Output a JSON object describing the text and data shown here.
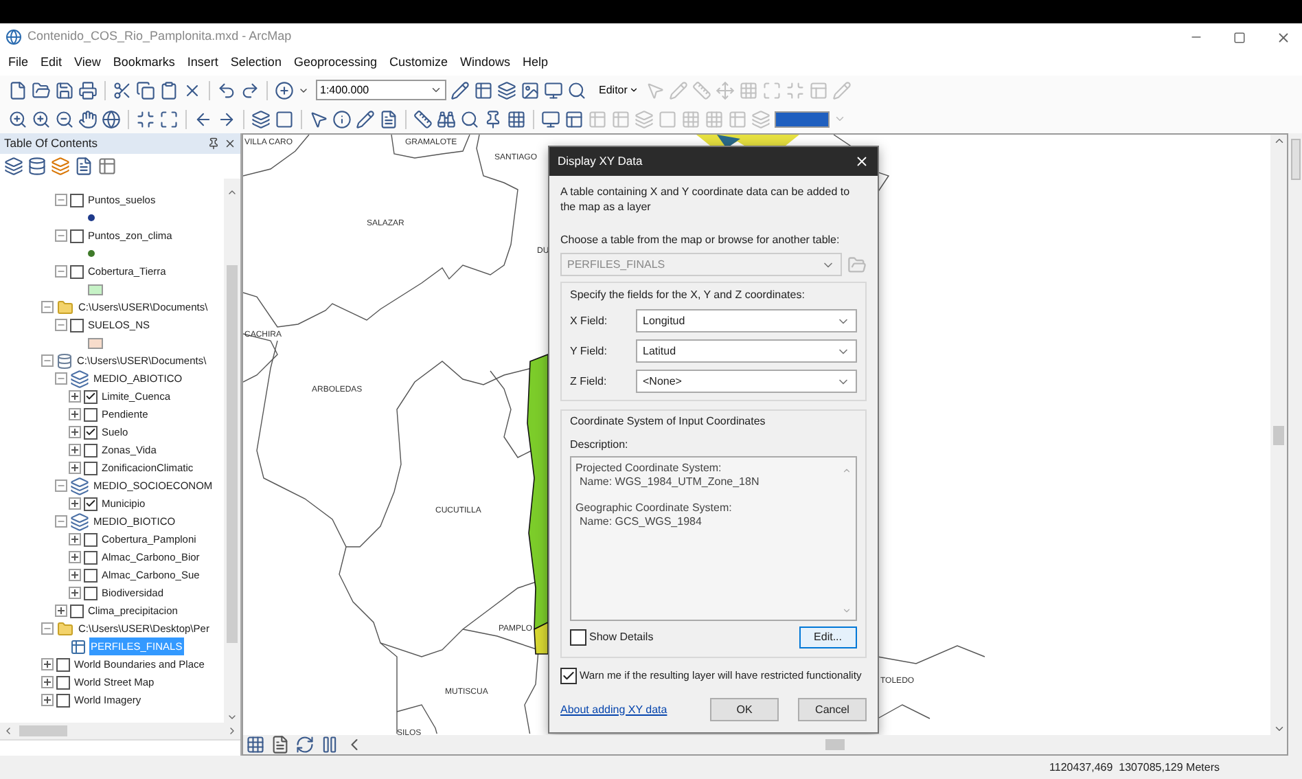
{
  "window": {
    "title": "Contenido_COS_Rio_Pamplonita.mxd - ArcMap"
  },
  "menu": [
    "File",
    "Edit",
    "View",
    "Bookmarks",
    "Insert",
    "Selection",
    "Geoprocessing",
    "Customize",
    "Windows",
    "Help"
  ],
  "toolbar": {
    "scale": "1:400.000",
    "editor": "Editor"
  },
  "toc": {
    "title": "Table Of Contents",
    "continued_children": [
      {
        "kind": "layer",
        "label": "Puntos_suelos",
        "checked": false,
        "expanded": true,
        "selected": false,
        "symbol": {
          "kind": "point",
          "color": "#1e3a8a"
        }
      },
      {
        "kind": "layer",
        "label": "Puntos_zon_clima",
        "checked": false,
        "expanded": true,
        "selected": false,
        "symbol": {
          "kind": "point",
          "color": "#3f7a2a"
        }
      },
      {
        "kind": "layer",
        "label": "Cobertura_Tierra",
        "checked": false,
        "expanded": true,
        "selected": false,
        "symbol": {
          "kind": "fill",
          "color": "#c6f2c6"
        }
      }
    ],
    "items": [
      {
        "kind": "folder",
        "label": "C:\\Users\\USER\\Documents\\",
        "expanded": true,
        "selected": false,
        "children": [
          {
            "kind": "layer",
            "label": "SUELOS_NS",
            "checked": false,
            "expanded": true,
            "selected": false,
            "symbol": {
              "kind": "fill",
              "color": "#f7dccb"
            }
          }
        ]
      },
      {
        "kind": "database",
        "label": "C:\\Users\\USER\\Documents\\",
        "expanded": true,
        "selected": false,
        "children": [
          {
            "kind": "group",
            "label": "MEDIO_ABIOTICO",
            "expanded": true,
            "selected": false,
            "children": [
              {
                "kind": "layer",
                "label": "Limite_Cuenca",
                "checked": true,
                "expanded": false,
                "selected": false
              },
              {
                "kind": "layer",
                "label": "Pendiente",
                "checked": false,
                "expanded": false,
                "selected": false
              },
              {
                "kind": "layer",
                "label": "Suelo",
                "checked": true,
                "expanded": false,
                "selected": false
              },
              {
                "kind": "layer",
                "label": "Zonas_Vida",
                "checked": false,
                "expanded": false,
                "selected": false
              },
              {
                "kind": "layer",
                "label": "ZonificacionClimatic",
                "checked": false,
                "expanded": false,
                "selected": false
              }
            ]
          },
          {
            "kind": "group",
            "label": "MEDIO_SOCIOECONOM",
            "expanded": true,
            "selected": false,
            "children": [
              {
                "kind": "layer",
                "label": "Municipio",
                "checked": true,
                "expanded": false,
                "selected": false
              }
            ]
          },
          {
            "kind": "group",
            "label": "MEDIO_BIOTICO",
            "expanded": true,
            "selected": false,
            "children": [
              {
                "kind": "layer",
                "label": "Cobertura_Pamploni",
                "checked": false,
                "expanded": false,
                "selected": false
              },
              {
                "kind": "layer",
                "label": "Almac_Carbono_Bior",
                "checked": false,
                "expanded": false,
                "selected": false
              },
              {
                "kind": "layer",
                "label": "Almac_Carbono_Sue",
                "checked": false,
                "expanded": false,
                "selected": false
              },
              {
                "kind": "layer",
                "label": "Biodiversidad",
                "checked": false,
                "expanded": false,
                "selected": false
              }
            ]
          },
          {
            "kind": "layer",
            "label": "Clima_precipitacion",
            "checked": false,
            "expanded": false,
            "selected": false
          }
        ]
      },
      {
        "kind": "folder",
        "label": "C:\\Users\\USER\\Desktop\\Per",
        "expanded": true,
        "selected": false,
        "children": [
          {
            "kind": "table",
            "label": "PERFILES_FINALS",
            "selected": true
          }
        ]
      },
      {
        "kind": "layer",
        "label": "World Boundaries and Place",
        "checked": false,
        "expanded": false,
        "selected": false
      },
      {
        "kind": "layer",
        "label": "World Street Map",
        "checked": false,
        "expanded": false,
        "selected": false
      },
      {
        "kind": "layer",
        "label": "World Imagery",
        "checked": false,
        "expanded": false,
        "selected": false
      }
    ]
  },
  "map": {
    "labels": [
      "VILLA CARO",
      "GRAMALOTE",
      "SANTIAGO",
      "SALAZAR",
      "DU",
      "CACHIRA",
      "ARBOLEDAS",
      "CUCUTILLA",
      "PAMPLO",
      "MUTISCUA",
      "SILOS",
      "TOLEDO"
    ]
  },
  "dialog": {
    "title": "Display XY Data",
    "intro": "A table containing X and Y coordinate data can be added to the map as a layer",
    "choose_label": "Choose a table from the map or browse for another table:",
    "table_combo": {
      "value": "PERFILES_FINALS",
      "disabled": true
    },
    "fields_label": "Specify the fields for the X, Y and Z coordinates:",
    "fields": [
      {
        "label": "X Field:",
        "value": "Longitud"
      },
      {
        "label": "Y Field:",
        "value": "Latitud"
      },
      {
        "label": "Z Field:",
        "value": "<None>"
      }
    ],
    "coord_label": "Coordinate System of Input Coordinates",
    "description_label": "Description:",
    "description": [
      {
        "heading": "Projected Coordinate System:",
        "name": "Name: WGS_1984_UTM_Zone_18N"
      },
      {
        "heading": "Geographic Coordinate System:",
        "name": "Name: GCS_WGS_1984"
      }
    ],
    "show_details": {
      "label": "Show Details",
      "checked": false
    },
    "edit_button": "Edit...",
    "warn": {
      "label": "Warn me if the resulting layer will have restricted functionality",
      "checked": true
    },
    "link": "About adding XY data",
    "ok": "OK",
    "cancel": "Cancel"
  },
  "status_bar": {
    "coordinates": "1120437,469  1307085,129 Meters"
  }
}
